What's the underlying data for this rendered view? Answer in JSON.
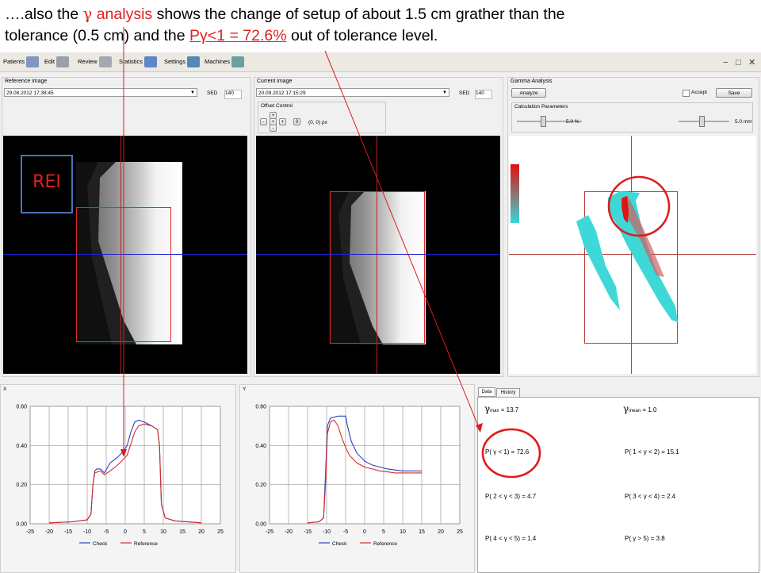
{
  "caption": {
    "line1_a": "….also the ",
    "gamma": "γ",
    "line1_b": " analysis",
    "line1_c": " shows the change of setup of about 1.5 cm grather than the",
    "line2_a": "tolerance  (0.5 cm)  and the  ",
    "line2_p": "Pγ<1 = 72.6%",
    "line2_c": "   out of tolerance level."
  },
  "toolbar": {
    "patients": "Patients",
    "edit": "Edit",
    "review": "Review",
    "statistics": "Statistics",
    "settings": "Settings",
    "machines": "Machines",
    "minimize": "−",
    "restore": "□",
    "close": "✕"
  },
  "reference_panel": {
    "title": "Reference image",
    "date": "29.08.2012 17:38:45",
    "sed_label": "SED",
    "sed_value": "140",
    "rei_label": "REI"
  },
  "current_panel": {
    "title": "Current image",
    "date": "20.09.2012 17:15:29",
    "sed_label": "SED",
    "sed_value": "140",
    "offset_title": "Offset Control",
    "offset_up": "+",
    "offset_left": "-",
    "offset_mid": "+",
    "offset_right": "+",
    "offset_down": "-",
    "offset_reset": "0",
    "offset_value": "(0, 0) px"
  },
  "gamma_panel": {
    "title": "Gamma Analysis",
    "analyze": "Analyze",
    "accept": "Accept",
    "save": "Save",
    "calc_title": "Calculation Parameters",
    "dose_value": "5.0 %",
    "dta_value": "5.0 mm",
    "dose_slider": 0.4,
    "dta_slider": 0.45
  },
  "plots": {
    "x_title": "X",
    "y_title": "Y",
    "legend_check": "Check",
    "legend_reference": "Reference",
    "check_color": "#2b3fbf",
    "reference_color": "#d42b2b"
  },
  "chart_data": [
    {
      "type": "line",
      "title": "X",
      "xlabel": "",
      "ylabel": "",
      "xlim": [
        -25,
        25
      ],
      "ylim": [
        0,
        0.6
      ],
      "x_ticks": [
        "-25",
        "-20",
        "-15",
        "-10",
        "-5",
        "0",
        "5",
        "10",
        "15",
        "20",
        "25"
      ],
      "y_ticks": [
        "0.00",
        "0.20",
        "0.40",
        "0.60"
      ],
      "grid": true,
      "legend": "bottom",
      "series": [
        {
          "name": "Check",
          "points": [
            [
              -20,
              0.005
            ],
            [
              -14,
              0.01
            ],
            [
              -10,
              0.02
            ],
            [
              -9,
              0.05
            ],
            [
              -8.5,
              0.2
            ],
            [
              -8,
              0.27
            ],
            [
              -7.5,
              0.28
            ],
            [
              -6.5,
              0.28
            ],
            [
              -5.5,
              0.26
            ],
            [
              -4,
              0.31
            ],
            [
              -2,
              0.34
            ],
            [
              -0.5,
              0.37
            ],
            [
              0.5,
              0.4
            ],
            [
              1.5,
              0.47
            ],
            [
              2.5,
              0.52
            ],
            [
              3.5,
              0.53
            ],
            [
              5,
              0.52
            ],
            [
              7,
              0.5
            ],
            [
              8.5,
              0.48
            ],
            [
              9,
              0.4
            ],
            [
              9.5,
              0.1
            ],
            [
              10.5,
              0.03
            ],
            [
              13,
              0.015
            ],
            [
              20,
              0.005
            ]
          ]
        },
        {
          "name": "Reference",
          "points": [
            [
              -20,
              0.005
            ],
            [
              -14,
              0.01
            ],
            [
              -10,
              0.02
            ],
            [
              -9,
              0.05
            ],
            [
              -8.5,
              0.2
            ],
            [
              -8,
              0.26
            ],
            [
              -6.5,
              0.27
            ],
            [
              -5.5,
              0.25
            ],
            [
              -4,
              0.27
            ],
            [
              -2,
              0.3
            ],
            [
              -0.5,
              0.33
            ],
            [
              0.5,
              0.35
            ],
            [
              1.5,
              0.41
            ],
            [
              2.5,
              0.47
            ],
            [
              3.5,
              0.5
            ],
            [
              5,
              0.51
            ],
            [
              7,
              0.5
            ],
            [
              8.5,
              0.48
            ],
            [
              9,
              0.4
            ],
            [
              9.5,
              0.1
            ],
            [
              10.5,
              0.03
            ],
            [
              13,
              0.015
            ],
            [
              20,
              0.005
            ]
          ]
        }
      ]
    },
    {
      "type": "line",
      "title": "Y",
      "xlabel": "",
      "ylabel": "",
      "xlim": [
        -25,
        25
      ],
      "ylim": [
        0,
        0.6
      ],
      "x_ticks": [
        "-25",
        "-20",
        "-15",
        "-10",
        "-5",
        "0",
        "5",
        "10",
        "15",
        "20",
        "25"
      ],
      "y_ticks": [
        "0.00",
        "0.20",
        "0.40",
        "0.60"
      ],
      "grid": true,
      "legend": "bottom",
      "series": [
        {
          "name": "Check",
          "points": [
            [
              -15,
              0.005
            ],
            [
              -12,
              0.01
            ],
            [
              -10.8,
              0.03
            ],
            [
              -10.3,
              0.25
            ],
            [
              -9.8,
              0.5
            ],
            [
              -9,
              0.54
            ],
            [
              -7,
              0.55
            ],
            [
              -5,
              0.55
            ],
            [
              -4.5,
              0.5
            ],
            [
              -3.5,
              0.42
            ],
            [
              -2,
              0.36
            ],
            [
              0,
              0.32
            ],
            [
              2,
              0.3
            ],
            [
              4,
              0.29
            ],
            [
              6,
              0.28
            ],
            [
              8,
              0.275
            ],
            [
              10,
              0.27
            ],
            [
              15,
              0.27
            ]
          ]
        },
        {
          "name": "Reference",
          "points": [
            [
              -15,
              0.005
            ],
            [
              -12,
              0.01
            ],
            [
              -10.8,
              0.03
            ],
            [
              -10.3,
              0.2
            ],
            [
              -9.8,
              0.46
            ],
            [
              -9,
              0.52
            ],
            [
              -8,
              0.53
            ],
            [
              -7,
              0.5
            ],
            [
              -6,
              0.44
            ],
            [
              -5,
              0.39
            ],
            [
              -4,
              0.35
            ],
            [
              -2,
              0.31
            ],
            [
              0,
              0.29
            ],
            [
              2,
              0.28
            ],
            [
              4,
              0.27
            ],
            [
              6,
              0.265
            ],
            [
              8,
              0.26
            ],
            [
              10,
              0.26
            ],
            [
              15,
              0.26
            ]
          ]
        }
      ]
    }
  ],
  "data_panel": {
    "tab_data": "Data",
    "tab_history": "History",
    "gmax_sub": "max",
    "gmax_value": "=  13.7",
    "gmean_sub": "mean",
    "gmean_value": "=   1.0",
    "p1": "P(  γ  <   1) = 72.6",
    "p2": "P( 1 <  γ  < 2) = 15.1",
    "p3": "P( 2 <  γ  < 3) = 4.7",
    "p4": "P( 3 <  γ  < 4) = 2.4",
    "p5": "P( 4 <  γ  < 5) = 1.4",
    "p6": "P(  γ  >  5) = 3.8",
    "gamma_symbol": "γ"
  },
  "annotation_color": "#e01b1b"
}
